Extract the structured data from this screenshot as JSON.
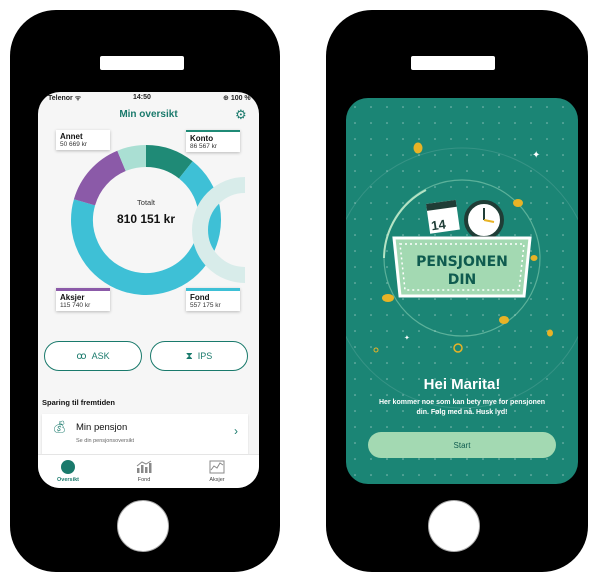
{
  "left_phone": {
    "status_bar": {
      "carrier": "Telenor",
      "time": "14:50",
      "battery": "100 %"
    },
    "header": {
      "title": "Min oversikt"
    },
    "donut": {
      "total_label": "Totalt",
      "total_value": "810 151 kr",
      "segments": [
        {
          "name": "Konto",
          "value": 86567,
          "color": "#1f8a76"
        },
        {
          "name": "Fond",
          "value": 557175,
          "color": "#3ec0d6"
        },
        {
          "name": "Aksjer",
          "value": 115740,
          "color": "#8b5aa8"
        },
        {
          "name": "Annet",
          "value": 50669,
          "color": "#aadfd3"
        }
      ]
    },
    "cards": {
      "annet": {
        "label": "Annet",
        "value": "50 669 kr"
      },
      "konto": {
        "label": "Konto",
        "value": "86 567 kr"
      },
      "aksjer": {
        "label": "Aksjer",
        "value": "115 740 kr"
      },
      "fond": {
        "label": "Fond",
        "value": "557 175 kr"
      }
    },
    "buttons": {
      "ask": "ASK",
      "ips": "IPS"
    },
    "section_title": "Sparing til fremtiden",
    "pension_row": {
      "title": "Min pensjon",
      "subtitle": "Se din pensjonsoversikt"
    },
    "tabs": [
      {
        "label": "Oversikt",
        "icon": "overview-icon",
        "active": true
      },
      {
        "label": "Fond",
        "icon": "fund-chart-icon",
        "active": false
      },
      {
        "label": "Aksjer",
        "icon": "stocks-chart-icon",
        "active": false
      }
    ]
  },
  "right_phone": {
    "badge": {
      "line1": "PENSJONEN",
      "line2": "DIN",
      "calendar_day": "14"
    },
    "greeting": "Hei Marita!",
    "message": "Her kommer noe som kan bety mye for pensjonen din. Følg med nå. Husk lyd!",
    "start_button": "Start"
  },
  "colors": {
    "teal": "#1a7a6c",
    "bg_teal": "#1b8575",
    "sign_green": "#a3d9b2",
    "sign_text": "#0f5b4f",
    "gold": "#e8b326"
  }
}
